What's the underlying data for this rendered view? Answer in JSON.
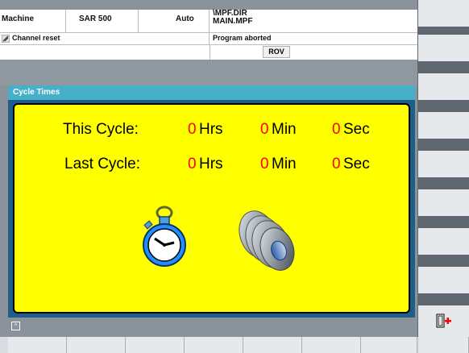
{
  "header": {
    "area": "Machine",
    "machine_name": "SAR 500",
    "mode": "Auto",
    "program_path_1": "\\MPF.DIR",
    "program_path_2": "MAIN.MPF",
    "channel_status": "Channel reset",
    "program_status": "Program aborted",
    "rov_label": "ROV"
  },
  "panel": {
    "title": "Cycle Times",
    "this_cycle": {
      "label": "This Cycle:",
      "hrs": "0",
      "hrs_unit": "Hrs",
      "min": "0",
      "min_unit": "Min",
      "sec": "0",
      "sec_unit": "Sec"
    },
    "last_cycle": {
      "label": "Last Cycle:",
      "hrs": "0",
      "hrs_unit": "Hrs",
      "min": "0",
      "min_unit": "Min",
      "sec": "0",
      "sec_unit": "Sec"
    }
  },
  "icons": {
    "stopwatch": "stopwatch-icon",
    "part": "turned-part-icon",
    "exit": "exit-door-icon",
    "recall": "recall-caret-icon"
  },
  "colors": {
    "panel_background": "#ffff00",
    "value_color": "#ff0000",
    "title_bar": "#47b0c8"
  }
}
